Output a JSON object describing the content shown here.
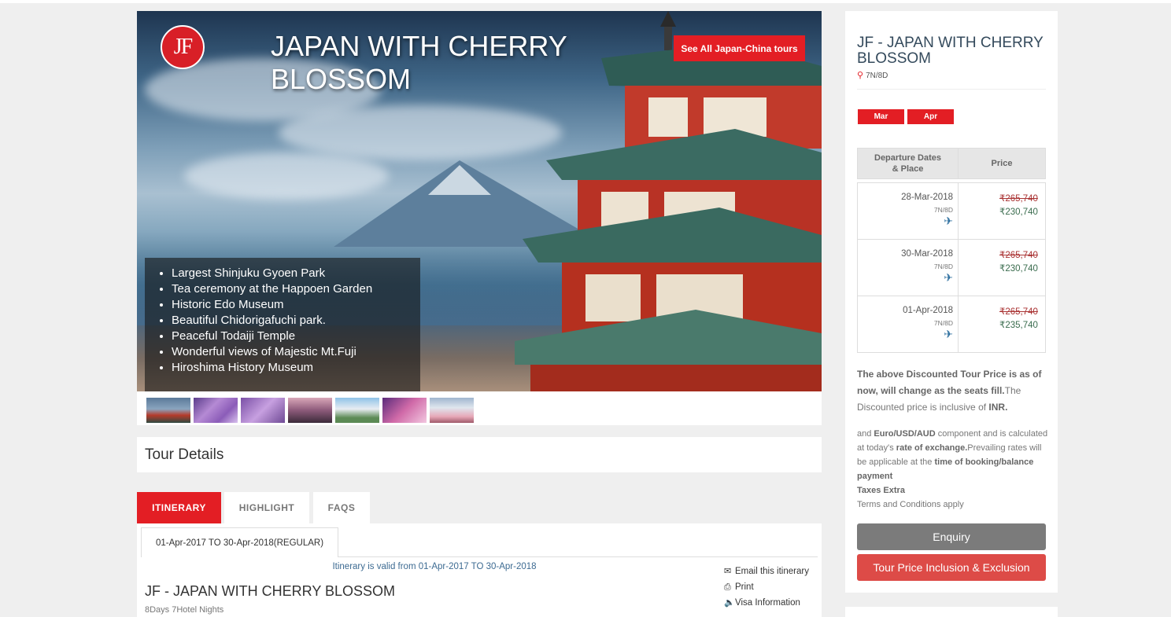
{
  "hero": {
    "logo": "JF",
    "title": "JAPAN WITH CHERRY BLOSSOM",
    "see_all_label": "See All Japan-China tours",
    "highlights": [
      "Largest Shinjuku Gyoen Park",
      "Tea ceremony at the Happoen Garden",
      "Historic Edo Museum",
      "Beautiful Chidorigafuchi park.",
      "Peaceful Todaiji Temple",
      "Wonderful views of Majestic Mt.Fuji",
      "Hiroshima History Museum"
    ]
  },
  "thumbnails": [
    "pagoda-thumb",
    "wisteria-thumb-1",
    "wisteria-thumb-2",
    "cherry-lane-thumb",
    "castle-thumb",
    "purple-temple-thumb",
    "fuji-thumb"
  ],
  "tour_details": {
    "heading": "Tour Details"
  },
  "tabs": {
    "itinerary": "ITINERARY",
    "highlight": "HIGHLIGHT",
    "faqs": "FAQS"
  },
  "itinerary": {
    "period_tab": "01-Apr-2017 TO 30-Apr-2018(REGULAR)",
    "valid_text": "Itinerary is valid from 01-Apr-2017 TO 30-Apr-2018",
    "title": "JF - JAPAN WITH CHERRY BLOSSOM",
    "subtitle": "8Days 7Hotel Nights",
    "actions": {
      "email": "Email this itinerary",
      "print": "Print",
      "visa": "Visa Information"
    }
  },
  "sidebar": {
    "title": "JF - JAPAN WITH CHERRY BLOSSOM",
    "duration": "7N/8D",
    "months": [
      "Mar",
      "Apr"
    ],
    "table_headers": {
      "dates": "Departure Dates & Place",
      "price": "Price"
    },
    "departures": [
      {
        "date": "28-Mar-2018",
        "nights": "7N/8D",
        "old_price": "₹265,740",
        "new_price": "₹230,740"
      },
      {
        "date": "30-Mar-2018",
        "nights": "7N/8D",
        "old_price": "₹265,740",
        "new_price": "₹230,740"
      },
      {
        "date": "01-Apr-2018",
        "nights": "7N/8D",
        "old_price": "₹265,740",
        "new_price": "₹235,740"
      }
    ],
    "note1": {
      "bold": "The above Discounted Tour Price is as of now, will change as the seats fill.",
      "rest": "The Discounted price is inclusive of ",
      "currency": "INR."
    },
    "note2": {
      "p1": "and ",
      "b1": "Euro/USD/AUD",
      "p2": " component and is calculated at today's ",
      "b2": "rate of exchange.",
      "p3": "Prevailing rates will be applicable at the ",
      "b3": "time of booking/balance payment",
      "b4": "Taxes Extra",
      "p4": "Terms and Conditions apply"
    },
    "enquiry_label": "Enquiry",
    "inclusion_label": "Tour Price Inclusion & Exclusion"
  },
  "colors": {
    "accent": "#e31e24",
    "enquiry": "#7b7b7b",
    "inclusion": "#dd4b47",
    "title": "#344a5c"
  }
}
